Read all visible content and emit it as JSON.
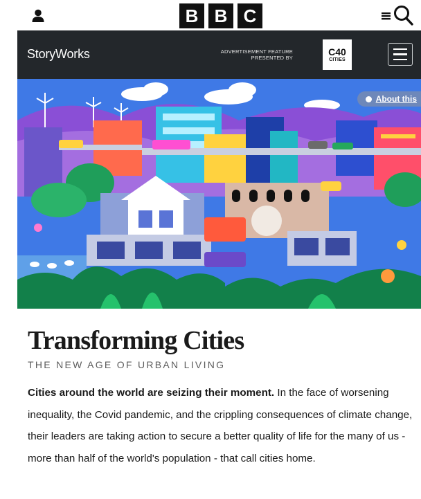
{
  "bbc_header": {
    "logo_letters": [
      "B",
      "B",
      "C"
    ],
    "account_icon": "person-icon",
    "menu_icon": "menu-lines-icon",
    "search_icon": "search-icon"
  },
  "storyworks_bar": {
    "title": "StoryWorks",
    "ad_label_line1": "ADVERTISEMENT FEATURE",
    "ad_label_line2": "PRESENTED BY",
    "sponsor_logo_top": "C40",
    "sponsor_logo_bottom": "CITIES",
    "menu_icon": "hamburger-icon",
    "background": "#23272b"
  },
  "hero": {
    "about_label": "About this",
    "sky_color": "#3f79e6"
  },
  "article": {
    "title": "Transforming Cities",
    "subtitle": "THE NEW AGE OF URBAN LIVING",
    "lead_bold": "Cities around the world are seizing their moment.",
    "lead_rest": " In the face of worsening inequality, the Covid pandemic, and the crippling consequences of climate change, their leaders are taking action to secure a better quality of life for the many of us - more than half of the world's population - that call cities home."
  }
}
